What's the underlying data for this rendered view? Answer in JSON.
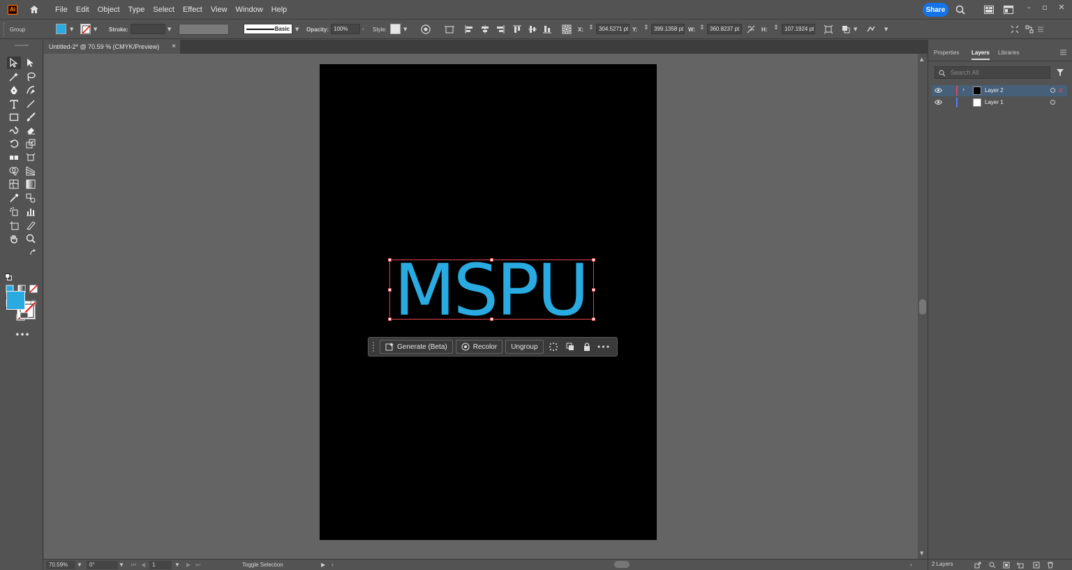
{
  "app": {
    "logo": "Ai",
    "menu": [
      "File",
      "Edit",
      "Object",
      "Type",
      "Select",
      "Effect",
      "View",
      "Window",
      "Help"
    ],
    "share_label": "Share"
  },
  "control": {
    "selection_type": "Group",
    "fill_color": "#29abe2",
    "stroke_label": "Stroke:",
    "brush_label": "Basic",
    "opacity_label": "Opacity:",
    "opacity_value": "100%",
    "style_label": "Style:",
    "x_label": "X:",
    "x_value": "304.5271 pt",
    "y_label": "Y:",
    "y_value": "399.1358 pt",
    "w_label": "W:",
    "w_value": "360.8237 pt",
    "h_label": "H:",
    "h_value": "107.1924 pt"
  },
  "document": {
    "tab_title": "Untitled-2* @ 70.59 % (CMYK/Preview)",
    "tab_close": "×"
  },
  "artwork": {
    "text": "MSPU",
    "text_color": "#29abe2",
    "artboard_color": "#000000"
  },
  "taskbar": {
    "generate_label": "Generate (Beta)",
    "recolor_label": "Recolor",
    "ungroup_label": "Ungroup"
  },
  "status": {
    "zoom": "70.59%",
    "rotation": "0°",
    "artboard_number": "1",
    "tool_hint": "Toggle Selection"
  },
  "panel": {
    "tabs": [
      "Properties",
      "Layers",
      "Libraries"
    ],
    "active_tab": "Layers",
    "search_placeholder": "Search All",
    "layers": [
      {
        "name": "Layer 2",
        "color": "#e0474c",
        "selected": true
      },
      {
        "name": "Layer 1",
        "color": "#4f7fff",
        "selected": false
      }
    ],
    "layer_count": "2 Layers"
  }
}
